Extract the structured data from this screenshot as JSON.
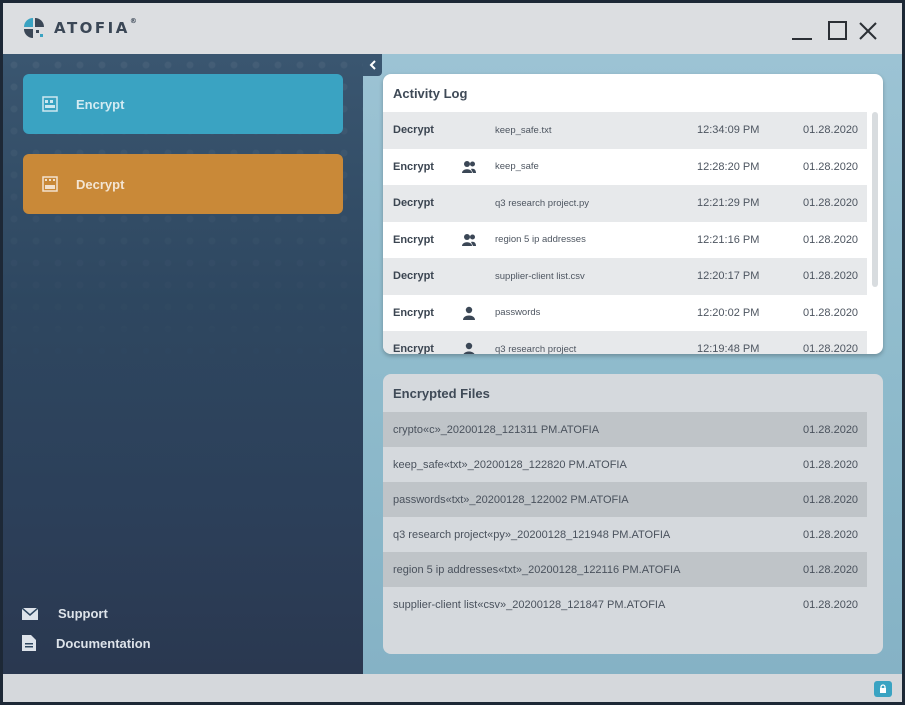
{
  "app": {
    "name": "ATOFIA",
    "trademark": "®"
  },
  "sidebar": {
    "nav": [
      {
        "label": "Encrypt",
        "color": "#3aa3c2"
      },
      {
        "label": "Decrypt",
        "color": "#c98938"
      }
    ],
    "links": [
      {
        "label": "Support",
        "icon": "mail-icon"
      },
      {
        "label": "Documentation",
        "icon": "document-icon"
      }
    ]
  },
  "activity_log": {
    "title": "Activity Log",
    "rows": [
      {
        "action": "Decrypt",
        "icon": "",
        "file": "keep_safe.txt",
        "time": "12:34:09 PM",
        "date": "01.28.2020"
      },
      {
        "action": "Encrypt",
        "icon": "users-icon",
        "file": "keep_safe",
        "time": "12:28:20 PM",
        "date": "01.28.2020"
      },
      {
        "action": "Decrypt",
        "icon": "",
        "file": "q3 research project.py",
        "time": "12:21:29 PM",
        "date": "01.28.2020"
      },
      {
        "action": "Encrypt",
        "icon": "users-icon",
        "file": "region 5 ip addresses",
        "time": "12:21:16 PM",
        "date": "01.28.2020"
      },
      {
        "action": "Decrypt",
        "icon": "",
        "file": "supplier-client list.csv",
        "time": "12:20:17 PM",
        "date": "01.28.2020"
      },
      {
        "action": "Encrypt",
        "icon": "user-icon",
        "file": "passwords",
        "time": "12:20:02 PM",
        "date": "01.28.2020"
      },
      {
        "action": "Encrypt",
        "icon": "user-icon",
        "file": "q3 research project",
        "time": "12:19:48 PM",
        "date": "01.28.2020"
      }
    ]
  },
  "encrypted_files": {
    "title": "Encrypted Files",
    "rows": [
      {
        "name": "crypto«c»_20200128_121311 PM.ATOFIA",
        "date": "01.28.2020"
      },
      {
        "name": "keep_safe«txt»_20200128_122820 PM.ATOFIA",
        "date": "01.28.2020"
      },
      {
        "name": "passwords«txt»_20200128_122002 PM.ATOFIA",
        "date": "01.28.2020"
      },
      {
        "name": "q3 research project«py»_20200128_121948 PM.ATOFIA",
        "date": "01.28.2020"
      },
      {
        "name": "region 5 ip addresses«txt»_20200128_122116 PM.ATOFIA",
        "date": "01.28.2020"
      },
      {
        "name": "supplier-client list«csv»_20200128_121847 PM.ATOFIA",
        "date": "01.28.2020"
      }
    ]
  },
  "colors": {
    "accent": "#3aa3c2",
    "decrypt": "#c98938",
    "sidebar": "#2e4760"
  }
}
